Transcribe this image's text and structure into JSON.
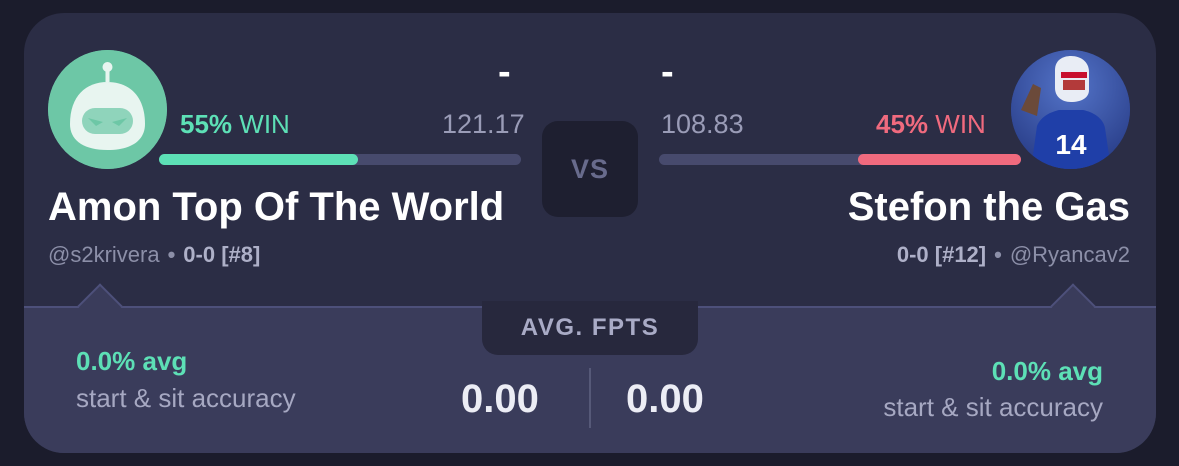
{
  "left_team": {
    "name": "Amon Top Of The World",
    "handle": "@s2krivera",
    "record": "0-0 [#8]",
    "projection_dash": "-",
    "win_percent_value": "55%",
    "win_label": "WIN",
    "win_fraction": 0.55,
    "projected_points": "121.17",
    "accuracy_percent": "0.0% avg",
    "accuracy_label": "start & sit accuracy",
    "avg_fpts": "0.00",
    "avatar_icon": "robot-avatar-icon"
  },
  "right_team": {
    "name": "Stefon the Gas",
    "handle": "@Ryancav2",
    "record": "0-0 [#12]",
    "projection_dash": "-",
    "win_percent_value": "45%",
    "win_label": "WIN",
    "win_fraction": 0.45,
    "projected_points": "108.83",
    "accuracy_percent": "0.0% avg",
    "accuracy_label": "start & sit accuracy",
    "avg_fpts": "0.00",
    "avatar_icon": "player-photo-avatar"
  },
  "vs_label": "VS",
  "avg_fpts_title": "AVG. FPTS",
  "separator_dot": "•",
  "colors": {
    "background": "#1b1c2c",
    "card": "#2b2d45",
    "panel": "#3a3c5b",
    "win_green": "#5de0b6",
    "lose_red": "#f06a7e",
    "bar_track": "#474a6d"
  }
}
